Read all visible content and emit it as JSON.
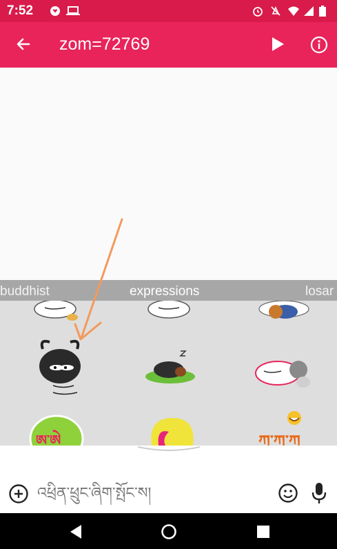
{
  "status_bar": {
    "time": "7:52"
  },
  "app_bar": {
    "title": "zom=72769"
  },
  "categories": [
    "buddhist",
    "expressions",
    "losar"
  ],
  "selected_category": "expressions",
  "sticker_texts": {
    "tibetan_lettering": "ཨ་ཨེ",
    "kakaka": "ཀ་ཀ་ཀ"
  },
  "composer": {
    "placeholder": "འཕྲིན་ཕྲུང་ཞིག་སྤོང་ས།"
  },
  "colors": {
    "status_bar": "#d81b4a",
    "app_bar": "#e8245a",
    "annotation_arrow": "#f29a5c"
  }
}
